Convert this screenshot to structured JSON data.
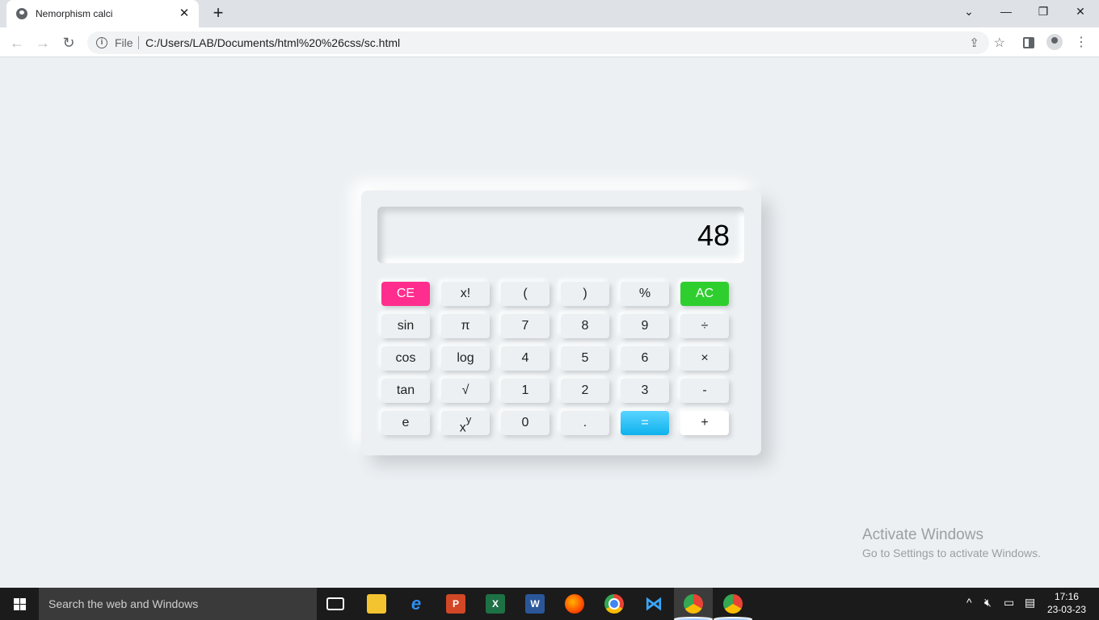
{
  "browser": {
    "tab_title": "Nemorphism calci",
    "tab_close": "✕",
    "new_tab": "+",
    "address_scheme": "File",
    "address_url": "C:/Users/LAB/Documents/html%20%26css/sc.html",
    "window_controls": [
      "⌄",
      "—",
      "❐",
      "✕"
    ]
  },
  "calculator": {
    "display_value": "48",
    "rows": [
      [
        "CE",
        "x!",
        "(",
        ")",
        "%",
        "AC"
      ],
      [
        "sin",
        "π",
        "7",
        "8",
        "9",
        "÷"
      ],
      [
        "cos",
        "log",
        "4",
        "5",
        "6",
        "×"
      ],
      [
        "tan",
        "√",
        "1",
        "2",
        "3",
        "-"
      ],
      [
        "e",
        "x",
        "0",
        ".",
        "=",
        "+"
      ]
    ],
    "power_superscript": "y",
    "colors": {
      "ce": "#ff2e8e",
      "ac": "#2fce2f",
      "equals": "#1ebcf2",
      "background": "#ecf0f3"
    }
  },
  "watermark": {
    "title": "Activate Windows",
    "subtitle": "Go to Settings to activate Windows."
  },
  "taskbar": {
    "search_placeholder": "Search the web and Windows",
    "apps": [
      "task-view-icon",
      "file-explorer-icon",
      "internet-explorer-icon",
      "powerpoint-icon",
      "excel-icon",
      "word-icon",
      "firefox-icon",
      "chrome-icon",
      "vscode-icon",
      "chrome-icon",
      "chrome-profile-icon"
    ],
    "time": "17:16",
    "date": "23-03-23"
  }
}
